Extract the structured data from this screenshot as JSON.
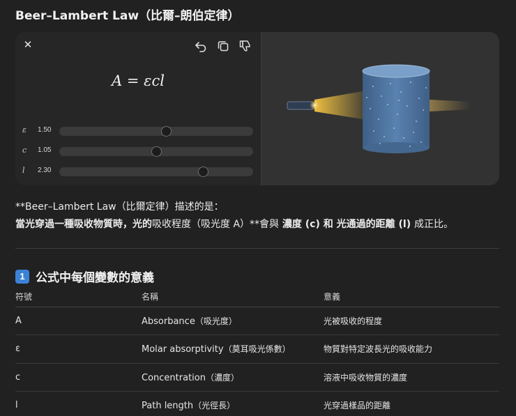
{
  "title": "Beer–Lambert Law（比爾–朗伯定律）",
  "widget": {
    "formula": "A = εcl",
    "sliders": [
      {
        "var": "ε",
        "value_text": "1.50",
        "fraction": 0.55
      },
      {
        "var": "c",
        "value_text": "1.05",
        "fraction": 0.5
      },
      {
        "var": "l",
        "value_text": "2.30",
        "fraction": 0.74
      }
    ],
    "tools": [
      "undo-icon",
      "copy-icon",
      "thumbs-down-icon"
    ]
  },
  "description": {
    "line1": "**Beer–Lambert Law（比爾定律）描述的是：",
    "line2_a": "當光穿過一種吸收物質時，光的",
    "line2_b": "吸收程度（吸光度 A）**會與",
    "line2_c": "濃度 (c)",
    "line2_d": "和",
    "line2_e": "光通過的距離 (l)",
    "line2_f": "成正比。"
  },
  "section": {
    "badge": "1",
    "title": "公式中每個變數的意義"
  },
  "table": {
    "headers": [
      "符號",
      "名稱",
      "意義"
    ],
    "rows": [
      {
        "symbol": "A",
        "name_en": "Absorbance",
        "name_zh": "（吸光度）",
        "meaning": "光被吸收的程度"
      },
      {
        "symbol": "ε",
        "name_en": "Molar absorptivity",
        "name_zh": "（莫耳吸光係數）",
        "meaning": "物質對特定波長光的吸收能力"
      },
      {
        "symbol": "c",
        "name_en": "Concentration",
        "name_zh": "（濃度）",
        "meaning": "溶液中吸收物質的濃度"
      },
      {
        "symbol": "l",
        "name_en": "Path length",
        "name_zh": "（光徑長）",
        "meaning": "光穿過樣品的距離"
      }
    ]
  },
  "colors": {
    "background": "#212121",
    "liquid": "#4a6f9a",
    "light": "#f5c542",
    "badge": "#3b82d6"
  }
}
